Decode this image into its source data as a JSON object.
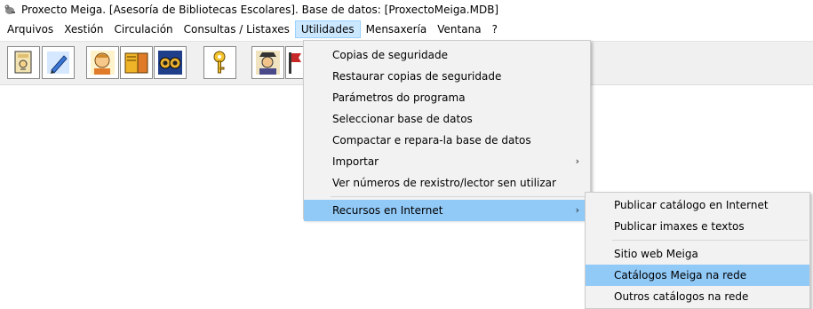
{
  "titlebar": {
    "title": "Proxecto Meiga.   [Asesoría de Bibliotecas Escolares]. Base de datos: [ProxectoMeiga.MDB]",
    "icon": "dog-app-icon"
  },
  "menubar": {
    "items": [
      {
        "label": "Arquivos"
      },
      {
        "label": "Xestión"
      },
      {
        "label": "Circulación"
      },
      {
        "label": "Consultas / Listaxes"
      },
      {
        "label": "Utilidades"
      },
      {
        "label": "Mensaxería"
      },
      {
        "label": "Ventana"
      },
      {
        "label": "?"
      }
    ],
    "active": "Utilidades"
  },
  "toolbar": {
    "buttons": [
      {
        "icon": "book-page-icon"
      },
      {
        "icon": "pencil-edit-icon"
      },
      {
        "icon": "reader-person-icon"
      },
      {
        "icon": "books-stack-icon"
      },
      {
        "icon": "binoculars-icon"
      },
      {
        "icon": "key-icon"
      },
      {
        "icon": "person-magnifier-icon"
      },
      {
        "icon": "flag-icon"
      }
    ]
  },
  "utilidades_menu": {
    "items": [
      {
        "label": "Copias de seguridade"
      },
      {
        "label": "Restaurar copias de seguridade"
      },
      {
        "label": "Parámetros do programa"
      },
      {
        "label": "Seleccionar base de datos"
      },
      {
        "label": "Compactar e repara-la base de datos"
      },
      {
        "label": "Importar",
        "arrow": "›"
      },
      {
        "label": "Ver números de rexistro/lector sen utilizar"
      },
      {
        "label": "Recursos en Internet",
        "arrow": "›"
      }
    ],
    "highlighted": "Recursos en Internet"
  },
  "recursos_submenu": {
    "items": [
      {
        "label": "Publicar catálogo en Internet"
      },
      {
        "label": "Publicar imaxes e textos"
      },
      {
        "label": "Sitio web Meiga"
      },
      {
        "label": "Catálogos Meiga na rede"
      },
      {
        "label": "Outros catálogos na rede"
      }
    ],
    "highlighted": "Catálogos Meiga na rede"
  },
  "colors": {
    "menu_highlight": "#91c9f7",
    "menubar_active": "#cce8ff",
    "menu_bg": "#f2f2f2",
    "toolbar_bg": "#f0f0f0"
  }
}
